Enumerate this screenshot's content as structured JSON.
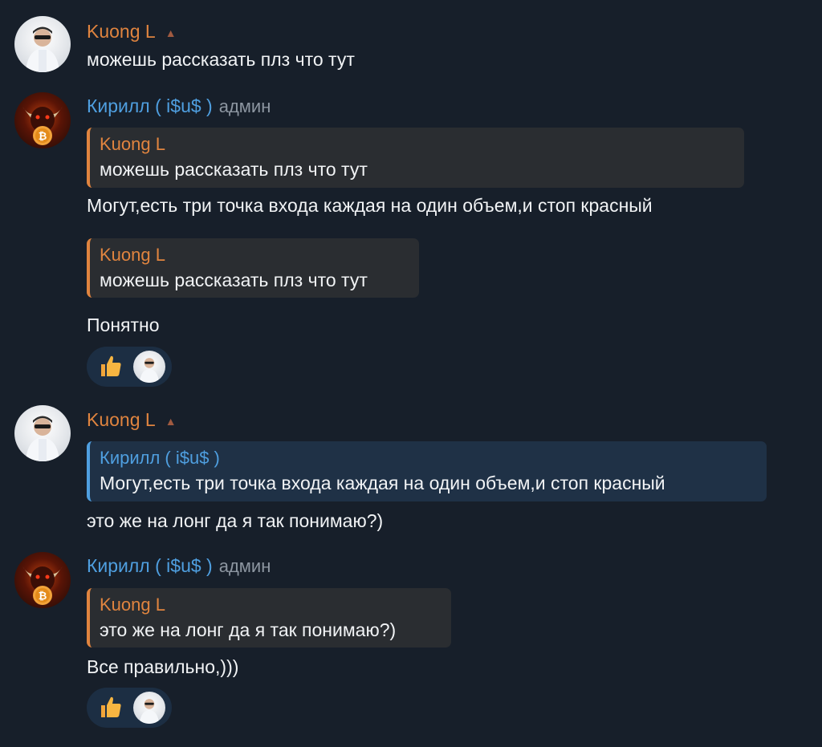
{
  "messages": [
    {
      "author": "Kuong L",
      "text": "можешь рассказать плз что тут"
    },
    {
      "author": "Кирилл ( i$u$ )",
      "role": "админ",
      "quote": {
        "author": "Kuong L",
        "text": "можешь рассказать плз что тут"
      },
      "text": "Могут,есть три точка входа каждая на один объем,и стоп красный"
    },
    {
      "quote": {
        "author": "Kuong L",
        "text": "можешь рассказать плз что тут"
      },
      "text": "Понятно"
    },
    {
      "author": "Kuong L",
      "quote": {
        "author": "Кирилл ( i$u$ )",
        "text": "Могут,есть три точка входа каждая на один объем,и стоп красный"
      },
      "text": "это же на лонг да я так понимаю?)"
    },
    {
      "author": "Кирилл ( i$u$ )",
      "role": "админ",
      "quote": {
        "author": "Kuong L",
        "text": "это же на лонг да я так понимаю?)"
      },
      "text": "Все правильно,)))"
    }
  ],
  "reactions": [
    {
      "emoji": "thumbs-up-icon"
    },
    {
      "emoji": "thumbs-up-icon"
    }
  ],
  "colors": {
    "background": "#171f2a",
    "kuong_name": "#e0843f",
    "kirill_name": "#4f9fe0",
    "quote_bg": "#2a2d31",
    "quote_bg_blue": "#1f3146",
    "reaction_bg": "#1c2e43"
  }
}
